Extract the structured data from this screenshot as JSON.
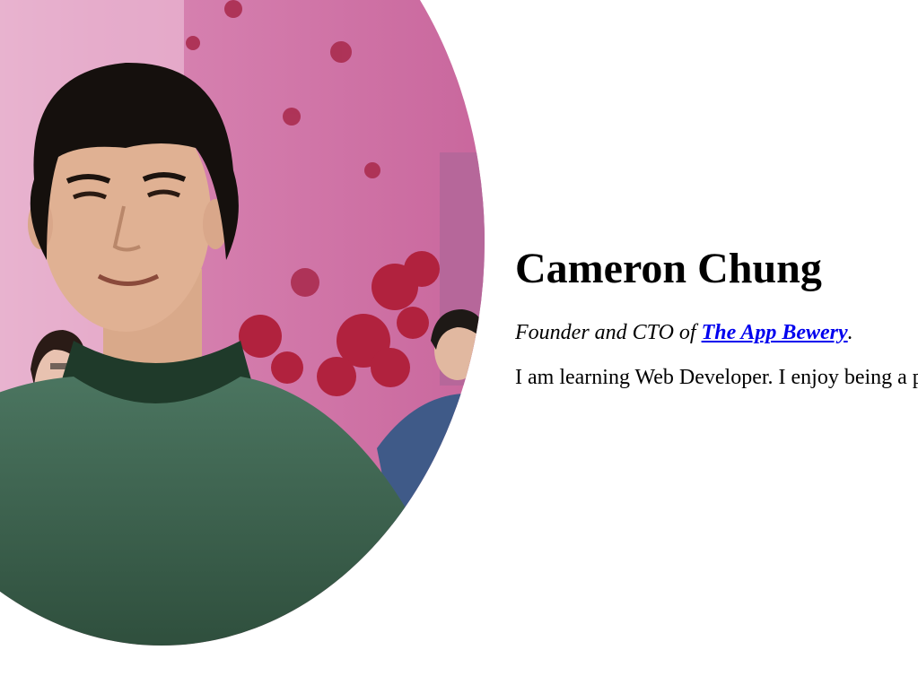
{
  "profile": {
    "photo_alt": "profile photo",
    "name": "Cameron Chung",
    "tagline_prefix": "Founder and CTO of ",
    "company_link": "The App Bewery",
    "tagline_suffix": ".",
    "bio": "I am learning Web Developer. I enjoy being a p"
  },
  "colors": {
    "link": "#0000ee",
    "text": "#000000",
    "background": "#ffffff"
  }
}
